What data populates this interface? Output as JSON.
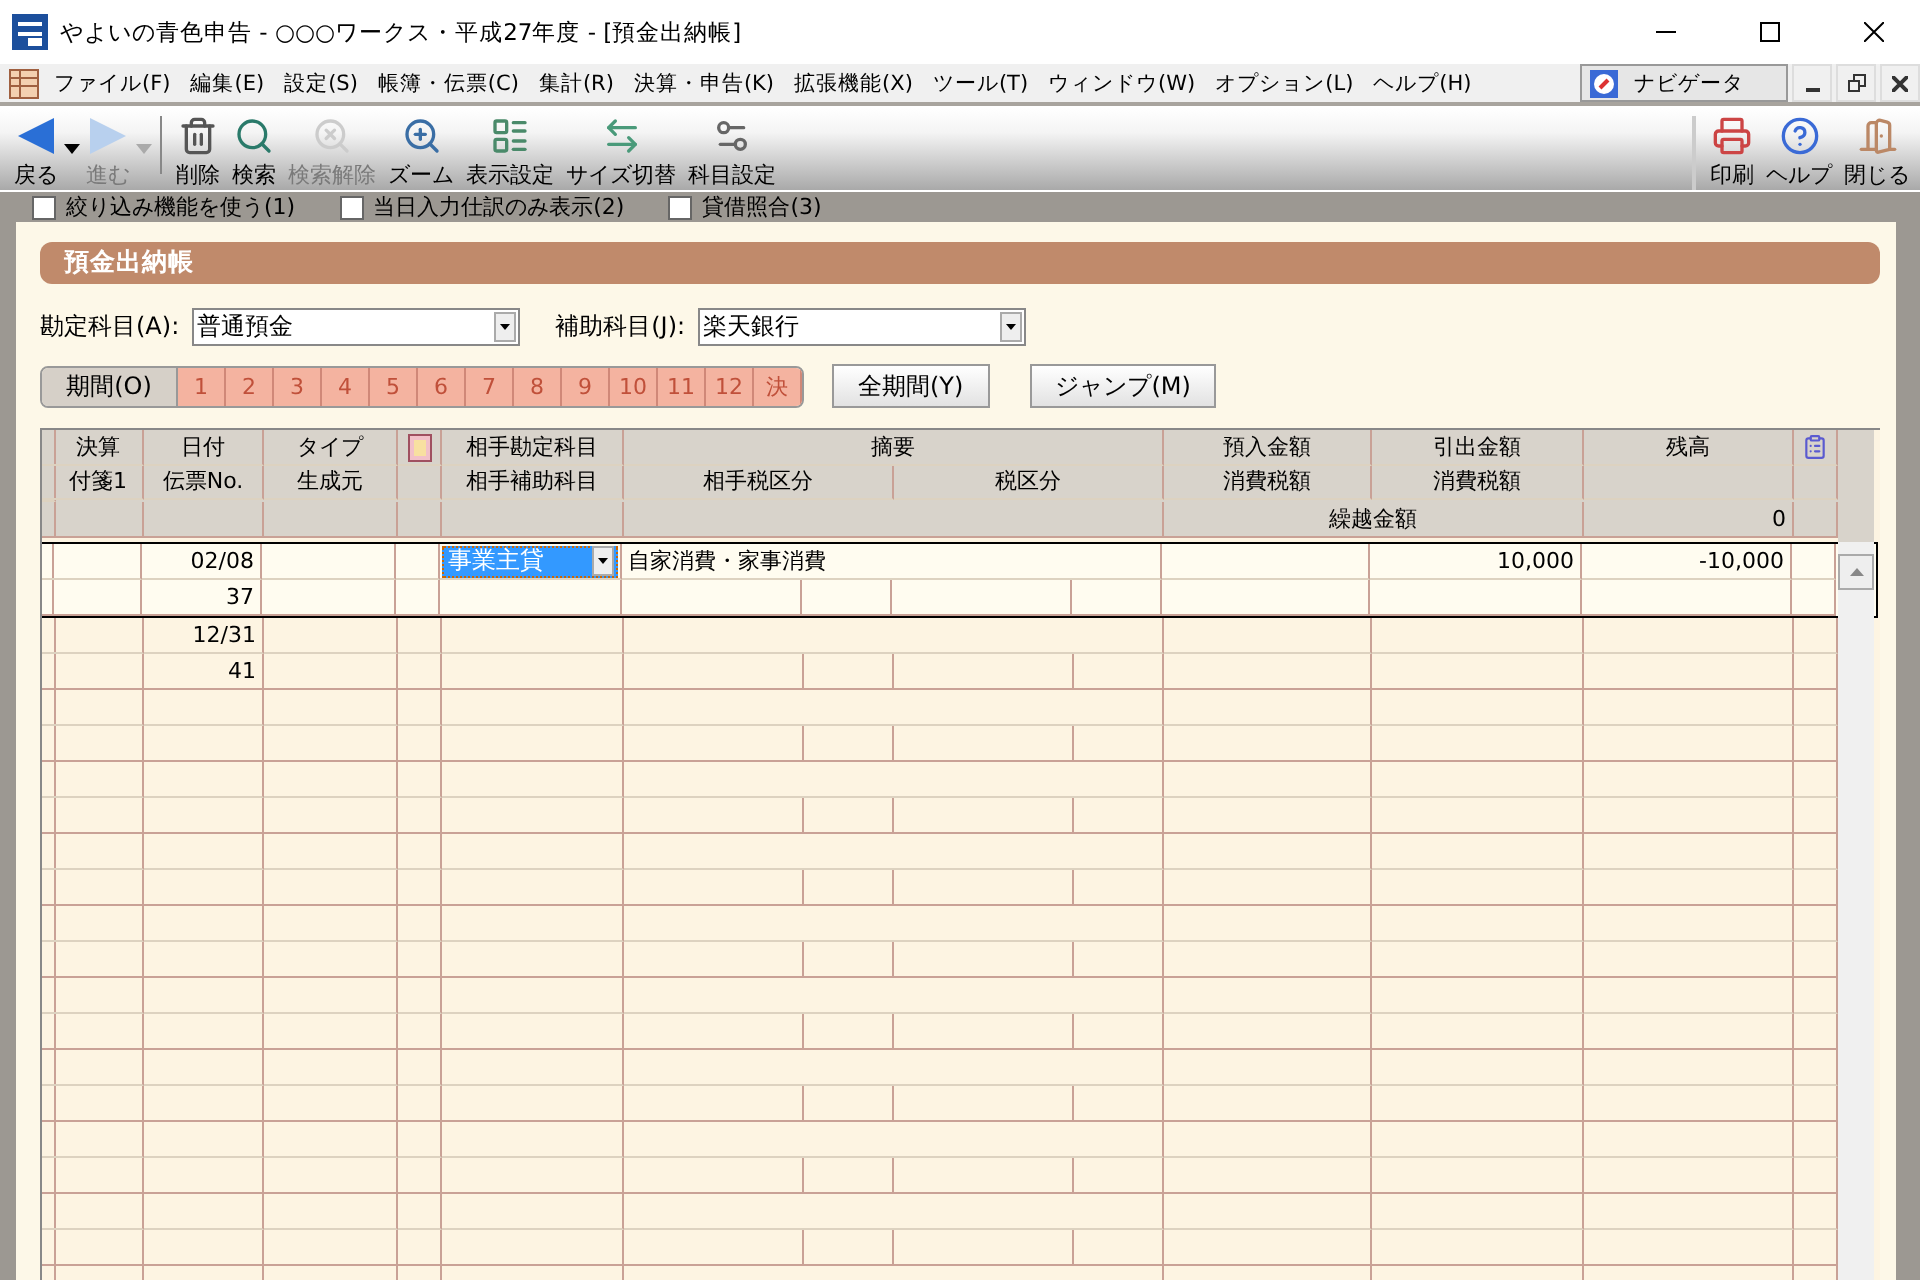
{
  "window": {
    "title": "やよいの青色申告 - ○○○ワークス・平成27年度 - [預金出納帳]"
  },
  "menu": [
    "ファイル(F)",
    "編集(E)",
    "設定(S)",
    "帳簿・伝票(C)",
    "集計(R)",
    "決算・申告(K)",
    "拡張機能(X)",
    "ツール(T)",
    "ウィンドウ(W)",
    "オプション(L)",
    "ヘルプ(H)"
  ],
  "navigator": "ナビゲータ",
  "toolbar": [
    {
      "label": "戻る",
      "disabled": false
    },
    {
      "label": "進む",
      "disabled": true
    },
    {
      "label": "削除",
      "disabled": false
    },
    {
      "label": "検索",
      "disabled": false
    },
    {
      "label": "検索解除",
      "disabled": true
    },
    {
      "label": "ズーム",
      "disabled": false
    },
    {
      "label": "表示設定",
      "disabled": false
    },
    {
      "label": "サイズ切替",
      "disabled": false
    },
    {
      "label": "科目設定",
      "disabled": false
    }
  ],
  "toolbar_right": [
    {
      "label": "印刷"
    },
    {
      "label": "ヘルプ"
    },
    {
      "label": "閉じる"
    }
  ],
  "options": [
    {
      "label": "絞り込み機能を使う(1)",
      "checked": false
    },
    {
      "label": "当日入力仕訳のみ表示(2)",
      "checked": false
    },
    {
      "label": "貸借照合(3)",
      "checked": false
    }
  ],
  "section_title": "預金出納帳",
  "fields": [
    {
      "label": "勘定科目(A):",
      "value": "普通預金"
    },
    {
      "label": "補助科目(J):",
      "value": "楽天銀行"
    }
  ],
  "period": {
    "label": "期間(O)",
    "months": [
      "1",
      "2",
      "3",
      "4",
      "5",
      "6",
      "7",
      "8",
      "9",
      "10",
      "11",
      "12",
      "決"
    ]
  },
  "buttons": [
    "全期間(Y)",
    "ジャンプ(M)"
  ],
  "table": {
    "header_1": [
      "決算",
      "日付",
      "タイプ",
      "相手勘定科目",
      "摘要",
      "預入金額",
      "引出金額",
      "残高"
    ],
    "header_2": [
      "付箋1",
      "伝票No.",
      "生成元",
      "相手補助科目",
      "相手税区分",
      "税区分",
      "消費税額",
      "消費税額"
    ],
    "carry_label": "繰越金額",
    "carry_value": "0",
    "rows": [
      {
        "date": "02/08",
        "slip_no": "37",
        "account": "事業主貸",
        "summary": "自家消費・家事消費",
        "withdrawal": "10,000",
        "balance": "-10,000",
        "selected": true
      },
      {
        "date": "12/31",
        "slip_no": "41",
        "selected": false
      }
    ]
  }
}
